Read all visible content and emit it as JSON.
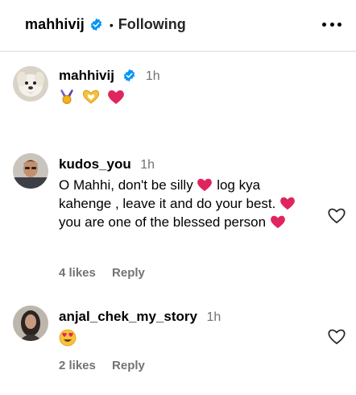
{
  "header": {
    "username": "mahhivij",
    "separator": "•",
    "follow_status": "Following"
  },
  "caption": {
    "username": "mahhivij",
    "time": "1h",
    "emojis": [
      "medal-icon",
      "heart-hands-icon",
      "red-heart-icon"
    ]
  },
  "comments": [
    {
      "username": "kudos_you",
      "time": "1h",
      "text_parts": [
        "O Mahhi, don't be silly",
        "log kya kahenge , leave it and do your best.",
        "you are one of the blessed person"
      ],
      "likes": "4 likes",
      "reply": "Reply"
    },
    {
      "username": "anjal_chek_my_story",
      "time": "1h",
      "emoji": "heart-eyes-icon",
      "likes": "2 likes",
      "reply": "Reply"
    }
  ],
  "colors": {
    "verified": "#0095f6",
    "muted": "#737373",
    "heart": "#e0245e"
  }
}
